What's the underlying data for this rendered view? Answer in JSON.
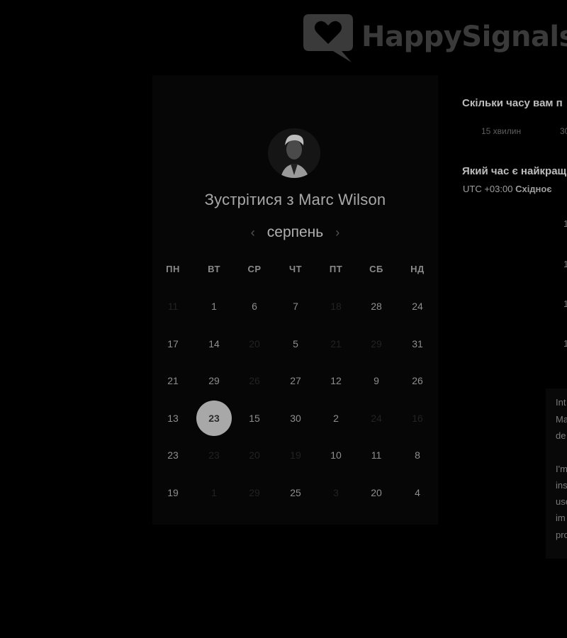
{
  "logo": {
    "text": "HappySignals"
  },
  "card": {
    "title": "Зустрітися з Marc Wilson",
    "month": "серпень",
    "prev_arrow": "‹",
    "next_arrow": "›",
    "weekdays": [
      "ПН",
      "ВТ",
      "СР",
      "ЧТ",
      "ПТ",
      "СБ",
      "НД"
    ],
    "weeks": [
      [
        "11",
        "1",
        "6",
        "7",
        "18",
        "28",
        "24"
      ],
      [
        "17",
        "14",
        "20",
        "5",
        "21",
        "29",
        "31"
      ],
      [
        "21",
        "29",
        "26",
        "27",
        "12",
        "9",
        "26"
      ],
      [
        "13",
        "23",
        "15",
        "30",
        "2",
        "24",
        "16"
      ],
      [
        "23",
        "23",
        "20",
        "19",
        "10",
        "11",
        "8"
      ],
      [
        "19",
        "1",
        "29",
        "25",
        "3",
        "20",
        "4"
      ]
    ],
    "dim_cells": [
      [
        true,
        false,
        false,
        false,
        true,
        false,
        false
      ],
      [
        false,
        false,
        true,
        false,
        true,
        true,
        false
      ],
      [
        false,
        false,
        true,
        false,
        false,
        false,
        false
      ],
      [
        false,
        false,
        false,
        false,
        false,
        true,
        true
      ],
      [
        false,
        true,
        true,
        true,
        false,
        false,
        false
      ],
      [
        false,
        true,
        true,
        false,
        true,
        false,
        false
      ]
    ],
    "selected": {
      "row": 3,
      "col": 1
    }
  },
  "right": {
    "duration_question": "Скільки часу вам п",
    "durations": [
      "15 хвилин",
      "30"
    ],
    "time_question": "Який час є найкращ",
    "timezone_prefix": "UTC +03:00",
    "timezone_name": "Східноє",
    "slots": [
      "1",
      "1",
      "1",
      "1"
    ],
    "description_lines": [
      "Int",
      "Ma",
      "de",
      "",
      "I'm",
      "ins",
      "use",
      "im",
      "pro"
    ]
  }
}
